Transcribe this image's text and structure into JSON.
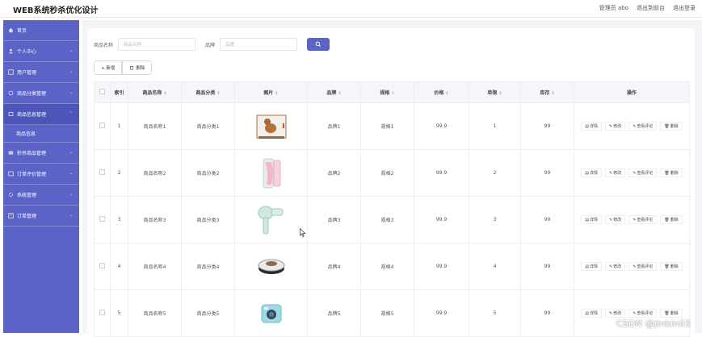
{
  "header": {
    "title": "WEB系统秒杀优化设计",
    "admin_label": "管理员 abo",
    "back_to_front": "退出到前台",
    "logout": "退出登录"
  },
  "sidebar": {
    "items": [
      {
        "label": "首页",
        "icon": "home-icon",
        "chevron": false
      },
      {
        "label": "个人中心",
        "icon": "user-icon",
        "chevron": true
      },
      {
        "label": "用户管理",
        "icon": "grid-icon",
        "chevron": true
      },
      {
        "label": "商品分类管理",
        "icon": "settings-icon",
        "chevron": true
      },
      {
        "label": "商品信息管理",
        "icon": "box-icon",
        "chevron": true,
        "expanded": true
      },
      {
        "label": "商品信息",
        "sub": true
      },
      {
        "label": "秒杀商品管理",
        "icon": "flash-icon",
        "chevron": true
      },
      {
        "label": "订单评价管理",
        "icon": "list-icon",
        "chevron": true
      },
      {
        "label": "系统管理",
        "icon": "gear-icon",
        "chevron": true
      },
      {
        "label": "订单管理",
        "icon": "order-icon",
        "chevron": true
      }
    ]
  },
  "search": {
    "name_label": "商品名称",
    "name_placeholder": "商品名称",
    "brand_label": "品牌",
    "brand_placeholder": "品牌"
  },
  "actions": {
    "add": "+ 新增",
    "delete": "删除"
  },
  "table": {
    "headers": [
      "",
      "索引",
      "商品名称",
      "商品分类",
      "图片",
      "品牌",
      "规格",
      "价格",
      "单限",
      "库存",
      "操作"
    ],
    "rows": [
      {
        "index": "1",
        "name": "商品名称1",
        "category": "商品分类1",
        "brand": "品牌1",
        "spec": "规格1",
        "price": "99.9",
        "limit": "1",
        "stock": "99",
        "image": "dog-kennel"
      },
      {
        "index": "2",
        "name": "商品名称2",
        "category": "商品分类2",
        "brand": "品牌2",
        "spec": "规格2",
        "price": "99.9",
        "limit": "2",
        "stock": "99",
        "image": "phone"
      },
      {
        "index": "3",
        "name": "商品名称3",
        "category": "商品分类3",
        "brand": "品牌3",
        "spec": "规格3",
        "price": "99.9",
        "limit": "3",
        "stock": "99",
        "image": "hair-dryer"
      },
      {
        "index": "4",
        "name": "商品名称4",
        "category": "商品分类4",
        "brand": "品牌4",
        "spec": "规格4",
        "price": "99.9",
        "limit": "4",
        "stock": "99",
        "image": "robot-vacuum"
      },
      {
        "index": "5",
        "name": "商品名称5",
        "category": "商品分类5",
        "brand": "品牌5",
        "spec": "规格5",
        "price": "99.9",
        "limit": "5",
        "stock": "99",
        "image": "instant-camera"
      }
    ],
    "op_detail": "详情",
    "op_edit": "修改",
    "op_review": "查看评论",
    "op_delete": "删除"
  },
  "watermark": "CSDN @jinkin03",
  "colors": {
    "sidebar": "#5b63c7",
    "accent": "#5b63c7"
  }
}
